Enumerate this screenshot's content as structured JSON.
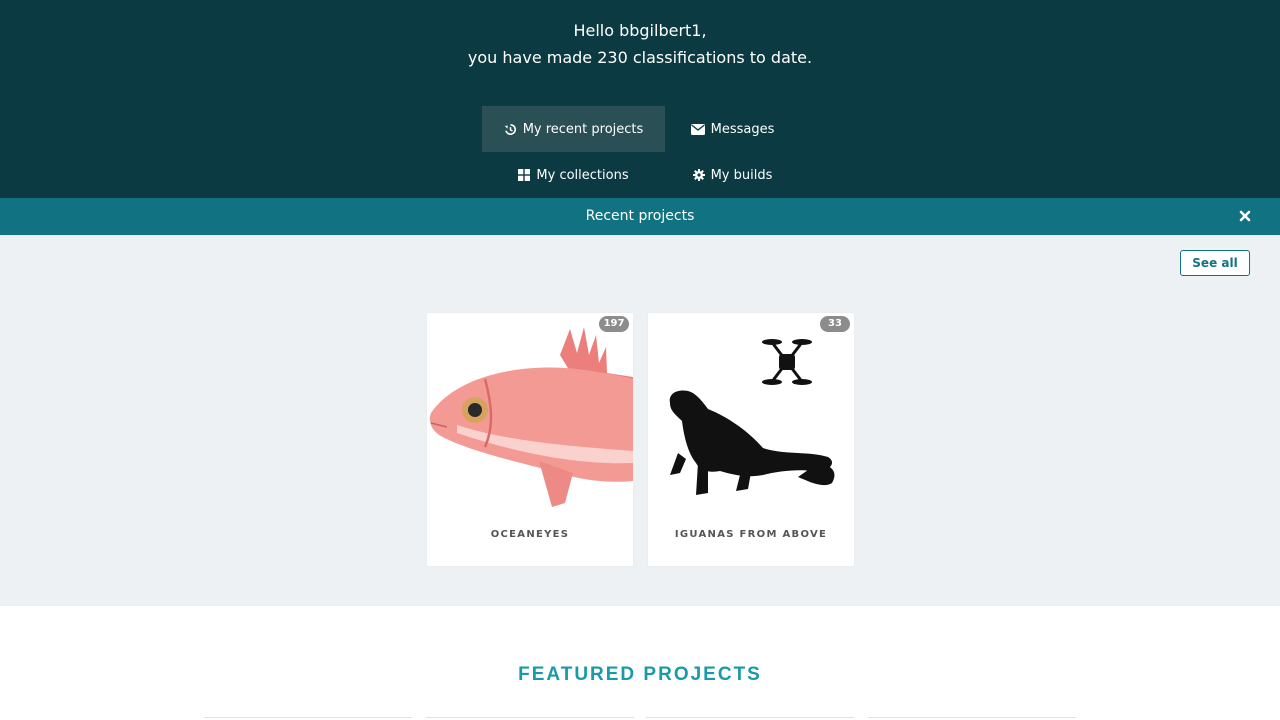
{
  "header": {
    "greeting": "Hello bbgilbert1,",
    "summary": "you have made 230 classifications to date."
  },
  "nav": {
    "recent_projects": "My recent projects",
    "messages": "Messages",
    "collections": "My collections",
    "builds": "My builds"
  },
  "banner": {
    "title": "Recent projects"
  },
  "recent": {
    "see_all": "See all",
    "projects": [
      {
        "name": "OCEANEYES",
        "count": "197"
      },
      {
        "name": "IGUANAS FROM ABOVE",
        "count": "33"
      }
    ]
  },
  "featured": {
    "title": "FEATURED PROJECTS"
  },
  "colors": {
    "hero": "#0b3a42",
    "banner": "#117382",
    "accent": "#1a9aa8",
    "recent_bg": "#eef1f4"
  }
}
